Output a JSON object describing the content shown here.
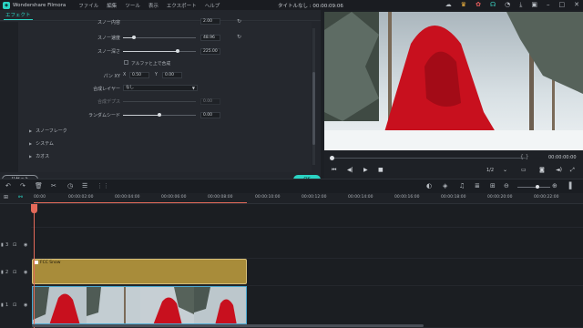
{
  "titlebar": {
    "app_name": "Wondershare Filmora",
    "menu": [
      "ファイル",
      "編集",
      "ツール",
      "表示",
      "エクスポート",
      "ヘルプ"
    ],
    "doc_title": "タイトルなし : 00:00:09:06"
  },
  "panel": {
    "tab": "エフェクト",
    "settings": {
      "partial_label": "スノー内容",
      "partial_value": "2.00",
      "speed_label": "スノー速度",
      "speed_value": "48.96",
      "speed_level": 0.15,
      "depth_label": "スノー深さ",
      "depth_value": "225.00",
      "depth_level": 0.75,
      "alpha_label": "アルファと上で合成",
      "pan_label": "パン XY",
      "pan_x_label": "X",
      "pan_x_value": "0.50",
      "pan_y_label": "Y",
      "pan_y_value": "0.00",
      "blend_label": "合成レイヤー",
      "blend_value": "なし",
      "blend_depth_label": "合成デプス",
      "blend_depth_value": "0.00",
      "random_label": "ランダムシード",
      "random_value": "0.00",
      "random_level": 0.5
    },
    "sections": [
      "スノーフレーク",
      "システム",
      "カオス"
    ],
    "reset_label": "リセット",
    "ok_label": "OK"
  },
  "player": {
    "timecode": "00:00:00:00",
    "brackets": "{  }",
    "page_select": "1/2",
    "progress": 0
  },
  "timeline": {
    "ruler": [
      "00:00",
      "00:00:02:00",
      "00:00:04:00",
      "00:00:06:00",
      "00:00:08:00",
      "00:00:10:00",
      "00:00:12:00",
      "00:00:14:00",
      "00:00:16:00",
      "00:00:18:00",
      "00:00:20:00",
      "00:00:22:00"
    ],
    "effect_clip": "FCC Snow",
    "track_numbers": [
      "3",
      "2",
      "1"
    ]
  },
  "colors": {
    "accent": "#2bd4c4",
    "playhead": "#e46a5a",
    "effect_clip": "#a88c3a"
  }
}
